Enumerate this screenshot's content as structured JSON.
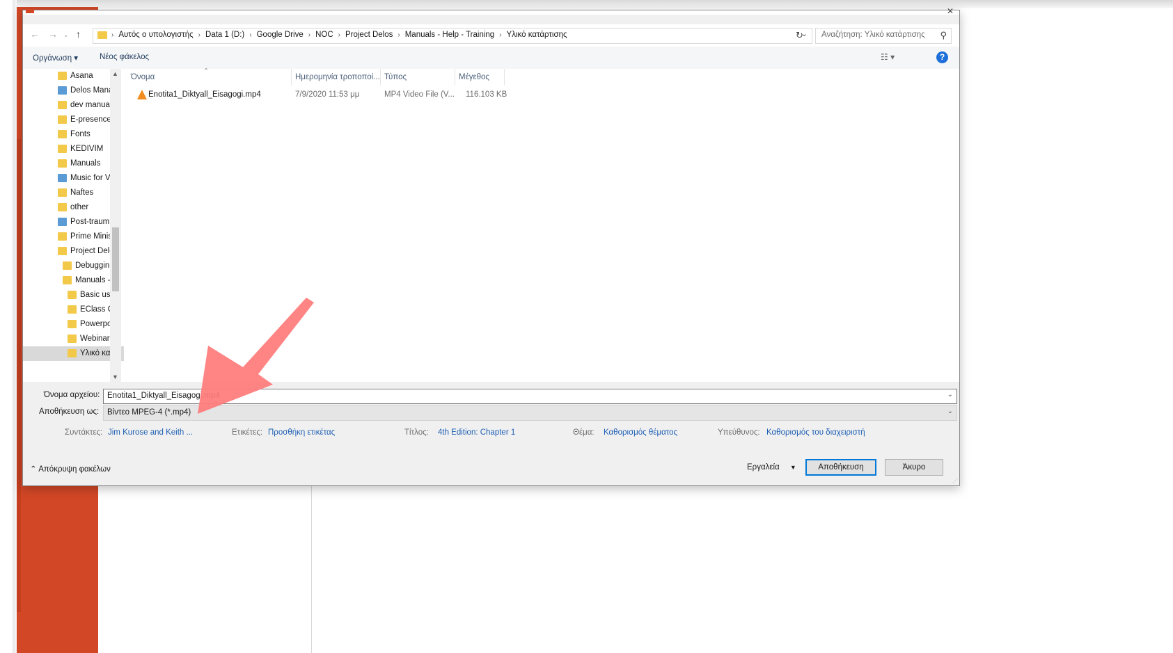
{
  "address": {
    "crumbs": [
      "Αυτός ο υπολογιστής",
      "Data 1 (D:)",
      "Google Drive",
      "NOC",
      "Project Delos",
      "Manuals - Help - Training",
      "Υλικό κατάρτισης"
    ],
    "search_placeholder": "Αναζήτηση: Υλικό κατάρτισης"
  },
  "toolbar": {
    "organize": "Οργάνωση ▾",
    "new_folder": "Νέος φάκελος",
    "help": "?"
  },
  "nav_items": [
    {
      "label": "Asana",
      "icon": "folder-icon"
    },
    {
      "label": "Delos Mana",
      "icon": "user-folder-icon"
    },
    {
      "label": "dev manual",
      "icon": "folder-icon"
    },
    {
      "label": "E-presence",
      "icon": "folder-icon"
    },
    {
      "label": "Fonts",
      "icon": "folder-icon"
    },
    {
      "label": "KEDIVIM",
      "icon": "folder-icon"
    },
    {
      "label": "Manuals",
      "icon": "folder-icon"
    },
    {
      "label": "Music for Vi",
      "icon": "user-folder-icon"
    },
    {
      "label": "Naftes",
      "icon": "folder-icon"
    },
    {
      "label": "other",
      "icon": "folder-icon"
    },
    {
      "label": "Post-traum",
      "icon": "user-folder-icon"
    },
    {
      "label": "Prime Minis",
      "icon": "folder-icon"
    },
    {
      "label": "Project Delc",
      "icon": "folder-icon"
    },
    {
      "label": "Debuggin",
      "icon": "folder-icon"
    },
    {
      "label": "Manuals -",
      "icon": "folder-icon"
    },
    {
      "label": "Basic use",
      "icon": "folder-icon"
    },
    {
      "label": "EClass C",
      "icon": "folder-icon"
    },
    {
      "label": "Powerpo",
      "icon": "folder-icon"
    },
    {
      "label": "Webinar",
      "icon": "folder-icon"
    },
    {
      "label": "Υλικό κα",
      "icon": "folder-icon"
    }
  ],
  "columns": {
    "name": "Όνομα",
    "date": "Ημερομηνία τροποποί...",
    "type": "Τύπος",
    "size": "Μέγεθος"
  },
  "file": {
    "name": "Enotita1_Diktyall_Eisagogi.mp4",
    "date": "7/9/2020 11:53 μμ",
    "type": "MP4 Video File (V...",
    "size": "116.103 KB"
  },
  "form": {
    "filename_label": "Όνομα αρχείου:",
    "filename_value": "Enotita1_Diktyall_Eisagogi.mp4",
    "savetype_label": "Αποθήκευση ως:",
    "savetype_value": "Βίντεο MPEG-4 (*.mp4)"
  },
  "meta": {
    "authors_label": "Συντάκτες:",
    "authors_value": "Jim Kurose and Keith ...",
    "tags_label": "Ετικέτες:",
    "tags_value": "Προσθήκη ετικέτας",
    "title_label": "Τίτλος:",
    "title_value": "4th Edition: Chapter 1",
    "subject_label": "Θέμα:",
    "subject_value": "Καθορισμός θέματος",
    "manager_label": "Υπεύθυνος:",
    "manager_value": "Καθορισμός του διαχειριστή"
  },
  "footer": {
    "hide_folders": "Απόκρυψη φακέλων",
    "tools": "Εργαλεία",
    "save": "Αποθήκευση",
    "cancel": "Άκυρο"
  },
  "colors": {
    "accent": "#d24726",
    "link": "#1e5fb4",
    "arrow": "#ff7a7a"
  }
}
